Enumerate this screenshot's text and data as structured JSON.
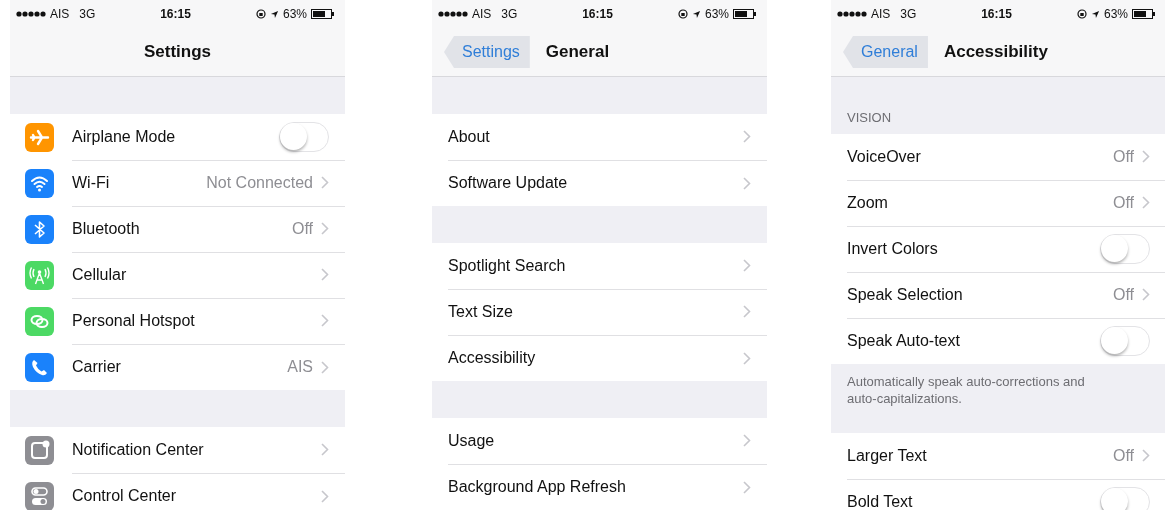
{
  "screens": [
    {
      "status": {
        "carrier": "AIS",
        "network": "3G",
        "time": "16:15",
        "battery": "63%"
      },
      "nav": {
        "title": "Settings"
      },
      "sections": [
        {
          "rows": [
            {
              "label": "Airplane Mode",
              "kind": "toggle",
              "on": false,
              "icon": {
                "kind": "airplane",
                "color": "#ff9500"
              }
            },
            {
              "label": "Wi-Fi",
              "kind": "link",
              "value": "Not Connected",
              "icon": {
                "kind": "wifi",
                "color": "#1a82fb"
              }
            },
            {
              "label": "Bluetooth",
              "kind": "link",
              "value": "Off",
              "icon": {
                "kind": "bluetooth",
                "color": "#1a82fb"
              }
            },
            {
              "label": "Cellular",
              "kind": "link",
              "icon": {
                "kind": "antenna",
                "color": "#4cd964"
              }
            },
            {
              "label": "Personal Hotspot",
              "kind": "link",
              "icon": {
                "kind": "chain",
                "color": "#4cd964"
              }
            },
            {
              "label": "Carrier",
              "kind": "link",
              "value": "AIS",
              "icon": {
                "kind": "phone",
                "color": "#1a82fb"
              }
            }
          ]
        },
        {
          "rows": [
            {
              "label": "Notification Center",
              "kind": "link",
              "icon": {
                "kind": "notification",
                "color": "#8e8e93"
              }
            },
            {
              "label": "Control Center",
              "kind": "link",
              "icon": {
                "kind": "switches",
                "color": "#8e8e93"
              }
            }
          ]
        }
      ]
    },
    {
      "status": {
        "carrier": "AIS",
        "network": "3G",
        "time": "16:15",
        "battery": "63%"
      },
      "nav": {
        "back": "Settings",
        "title": "General"
      },
      "sections": [
        {
          "rows": [
            {
              "label": "About",
              "kind": "link"
            },
            {
              "label": "Software Update",
              "kind": "link"
            }
          ]
        },
        {
          "rows": [
            {
              "label": "Spotlight Search",
              "kind": "link"
            },
            {
              "label": "Text Size",
              "kind": "link"
            },
            {
              "label": "Accessibility",
              "kind": "link"
            }
          ]
        },
        {
          "rows": [
            {
              "label": "Usage",
              "kind": "link"
            },
            {
              "label": "Background App Refresh",
              "kind": "link"
            }
          ]
        }
      ]
    },
    {
      "status": {
        "carrier": "AIS",
        "network": "3G",
        "time": "16:15",
        "battery": "63%"
      },
      "nav": {
        "back": "General",
        "title": "Accessibility"
      },
      "sections": [
        {
          "header": "VISION",
          "footer": "Automatically speak auto-corrections and auto-capitalizations.",
          "rows": [
            {
              "label": "VoiceOver",
              "kind": "link",
              "value": "Off"
            },
            {
              "label": "Zoom",
              "kind": "link",
              "value": "Off"
            },
            {
              "label": "Invert Colors",
              "kind": "toggle",
              "on": false
            },
            {
              "label": "Speak Selection",
              "kind": "link",
              "value": "Off"
            },
            {
              "label": "Speak Auto-text",
              "kind": "toggle",
              "on": false
            }
          ]
        },
        {
          "rows": [
            {
              "label": "Larger Text",
              "kind": "link",
              "value": "Off"
            },
            {
              "label": "Bold Text",
              "kind": "toggle",
              "on": false
            }
          ]
        }
      ]
    }
  ]
}
